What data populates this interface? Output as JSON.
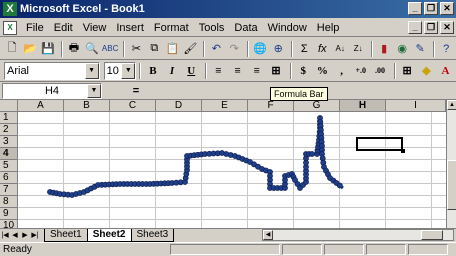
{
  "window": {
    "title": "Microsoft Excel - Book1",
    "app_icon": "X"
  },
  "menu": [
    "File",
    "Edit",
    "View",
    "Insert",
    "Format",
    "Tools",
    "Data",
    "Window",
    "Help"
  ],
  "toolbar_font": {
    "font": "Arial",
    "size": "10"
  },
  "formula_bar": {
    "name_box": "H4",
    "equals": "=",
    "tooltip": "Formula Bar"
  },
  "columns": [
    "A",
    "B",
    "C",
    "D",
    "E",
    "F",
    "G",
    "H",
    "I"
  ],
  "rows": [
    "1",
    "2",
    "3",
    "4",
    "5",
    "6",
    "7",
    "8",
    "9",
    "10"
  ],
  "active_column": "H",
  "active_row": "4",
  "sheets": [
    "Sheet1",
    "Sheet2",
    "Sheet3"
  ],
  "active_sheet": "Sheet2",
  "status": "Ready",
  "icons": {
    "new": "new-file-icon",
    "open": "open-folder-icon",
    "save": "save-icon",
    "print": "print-icon",
    "preview": "print-preview-icon",
    "spell": "spell-check-icon",
    "cut": "cut-icon",
    "copy": "copy-icon",
    "paste": "paste-icon",
    "brush": "format-painter-icon",
    "undo": "undo-icon",
    "redo": "redo-icon",
    "hyperlink": "hyperlink-icon",
    "web": "web-toolbar-icon",
    "sum": "autosum-icon",
    "fx": "function-icon",
    "sortasc": "sort-ascending-icon",
    "sortdesc": "sort-descending-icon",
    "chart": "chart-wizard-icon",
    "map": "map-icon",
    "drawing": "drawing-icon",
    "help": "help-icon"
  },
  "drawing_color": "#1f3f8a"
}
